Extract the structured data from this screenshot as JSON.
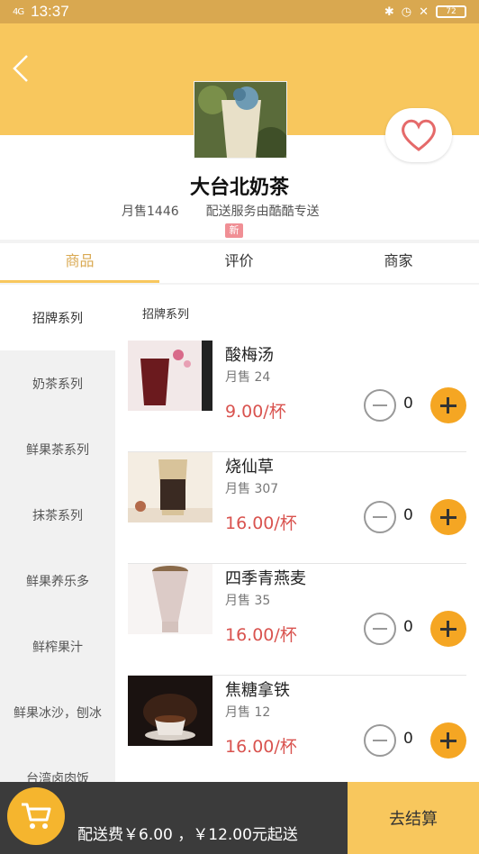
{
  "status_bar": {
    "signal": "4G",
    "time": "13:37",
    "battery": "72"
  },
  "shop": {
    "name": "大台北奶茶",
    "monthly_sales": "月售1446",
    "delivery": "配送服务由酷酷专送",
    "badge": "新"
  },
  "tabs": [
    {
      "label": "商品"
    },
    {
      "label": "评价"
    },
    {
      "label": "商家"
    }
  ],
  "categories": [
    {
      "label": "招牌系列"
    },
    {
      "label": "奶茶系列"
    },
    {
      "label": "鲜果茶系列"
    },
    {
      "label": "抹茶系列"
    },
    {
      "label": "鲜果养乐多"
    },
    {
      "label": "鲜榨果汁"
    },
    {
      "label": "鲜果冰沙，刨冰"
    },
    {
      "label": "台湾卤肉饭"
    }
  ],
  "section_title": "招牌系列",
  "products": [
    {
      "name": "酸梅汤",
      "sold": "月售 24",
      "price": "9.00/杯",
      "qty": "0"
    },
    {
      "name": "烧仙草",
      "sold": "月售 307",
      "price": "16.00/杯",
      "qty": "0"
    },
    {
      "name": "四季青燕麦",
      "sold": "月售 35",
      "price": "16.00/杯",
      "qty": "0"
    },
    {
      "name": "焦糖拿铁",
      "sold": "月售 12",
      "price": "16.00/杯",
      "qty": "0"
    }
  ],
  "cart": {
    "fee_text": "配送费￥6.00 ，￥12.00元起送",
    "checkout": "去结算"
  },
  "colors": {
    "accent": "#f8c75d",
    "price": "#d9534f",
    "plus": "#f5a623"
  }
}
